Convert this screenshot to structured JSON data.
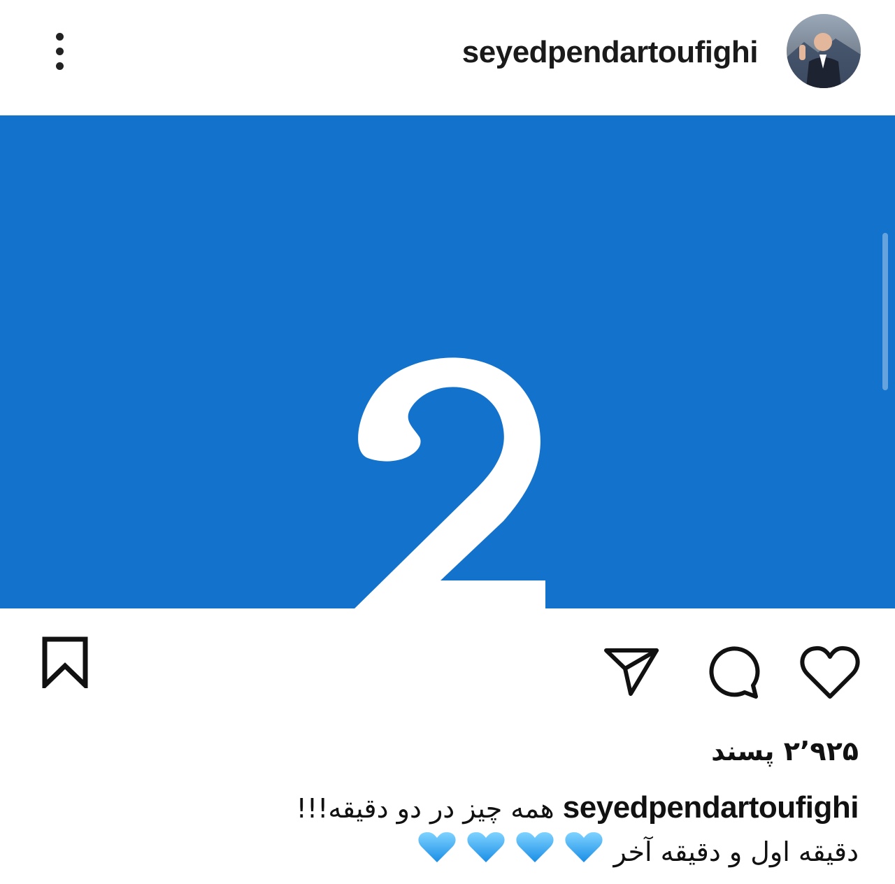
{
  "header": {
    "username": "seyedpendartoufighi",
    "more_icon": "more-vertical-icon",
    "avatar_icon": "profile-avatar"
  },
  "post": {
    "image_text": "2",
    "image_background": "#1272cc"
  },
  "actions": {
    "like_icon": "heart-icon",
    "comment_icon": "comment-icon",
    "share_icon": "send-icon",
    "save_icon": "bookmark-icon"
  },
  "likes": {
    "text": "۲٬۹۲۵ پسند"
  },
  "caption": {
    "username": "seyedpendartoufighi",
    "line1": "همه چیز در دو دقیقه!!!",
    "line2": "دقیقه اول و دقیقه آخر",
    "emoji_icon": "blue-heart-emoji",
    "emoji_count": 4,
    "emoji_color": "#2ba3f0"
  }
}
